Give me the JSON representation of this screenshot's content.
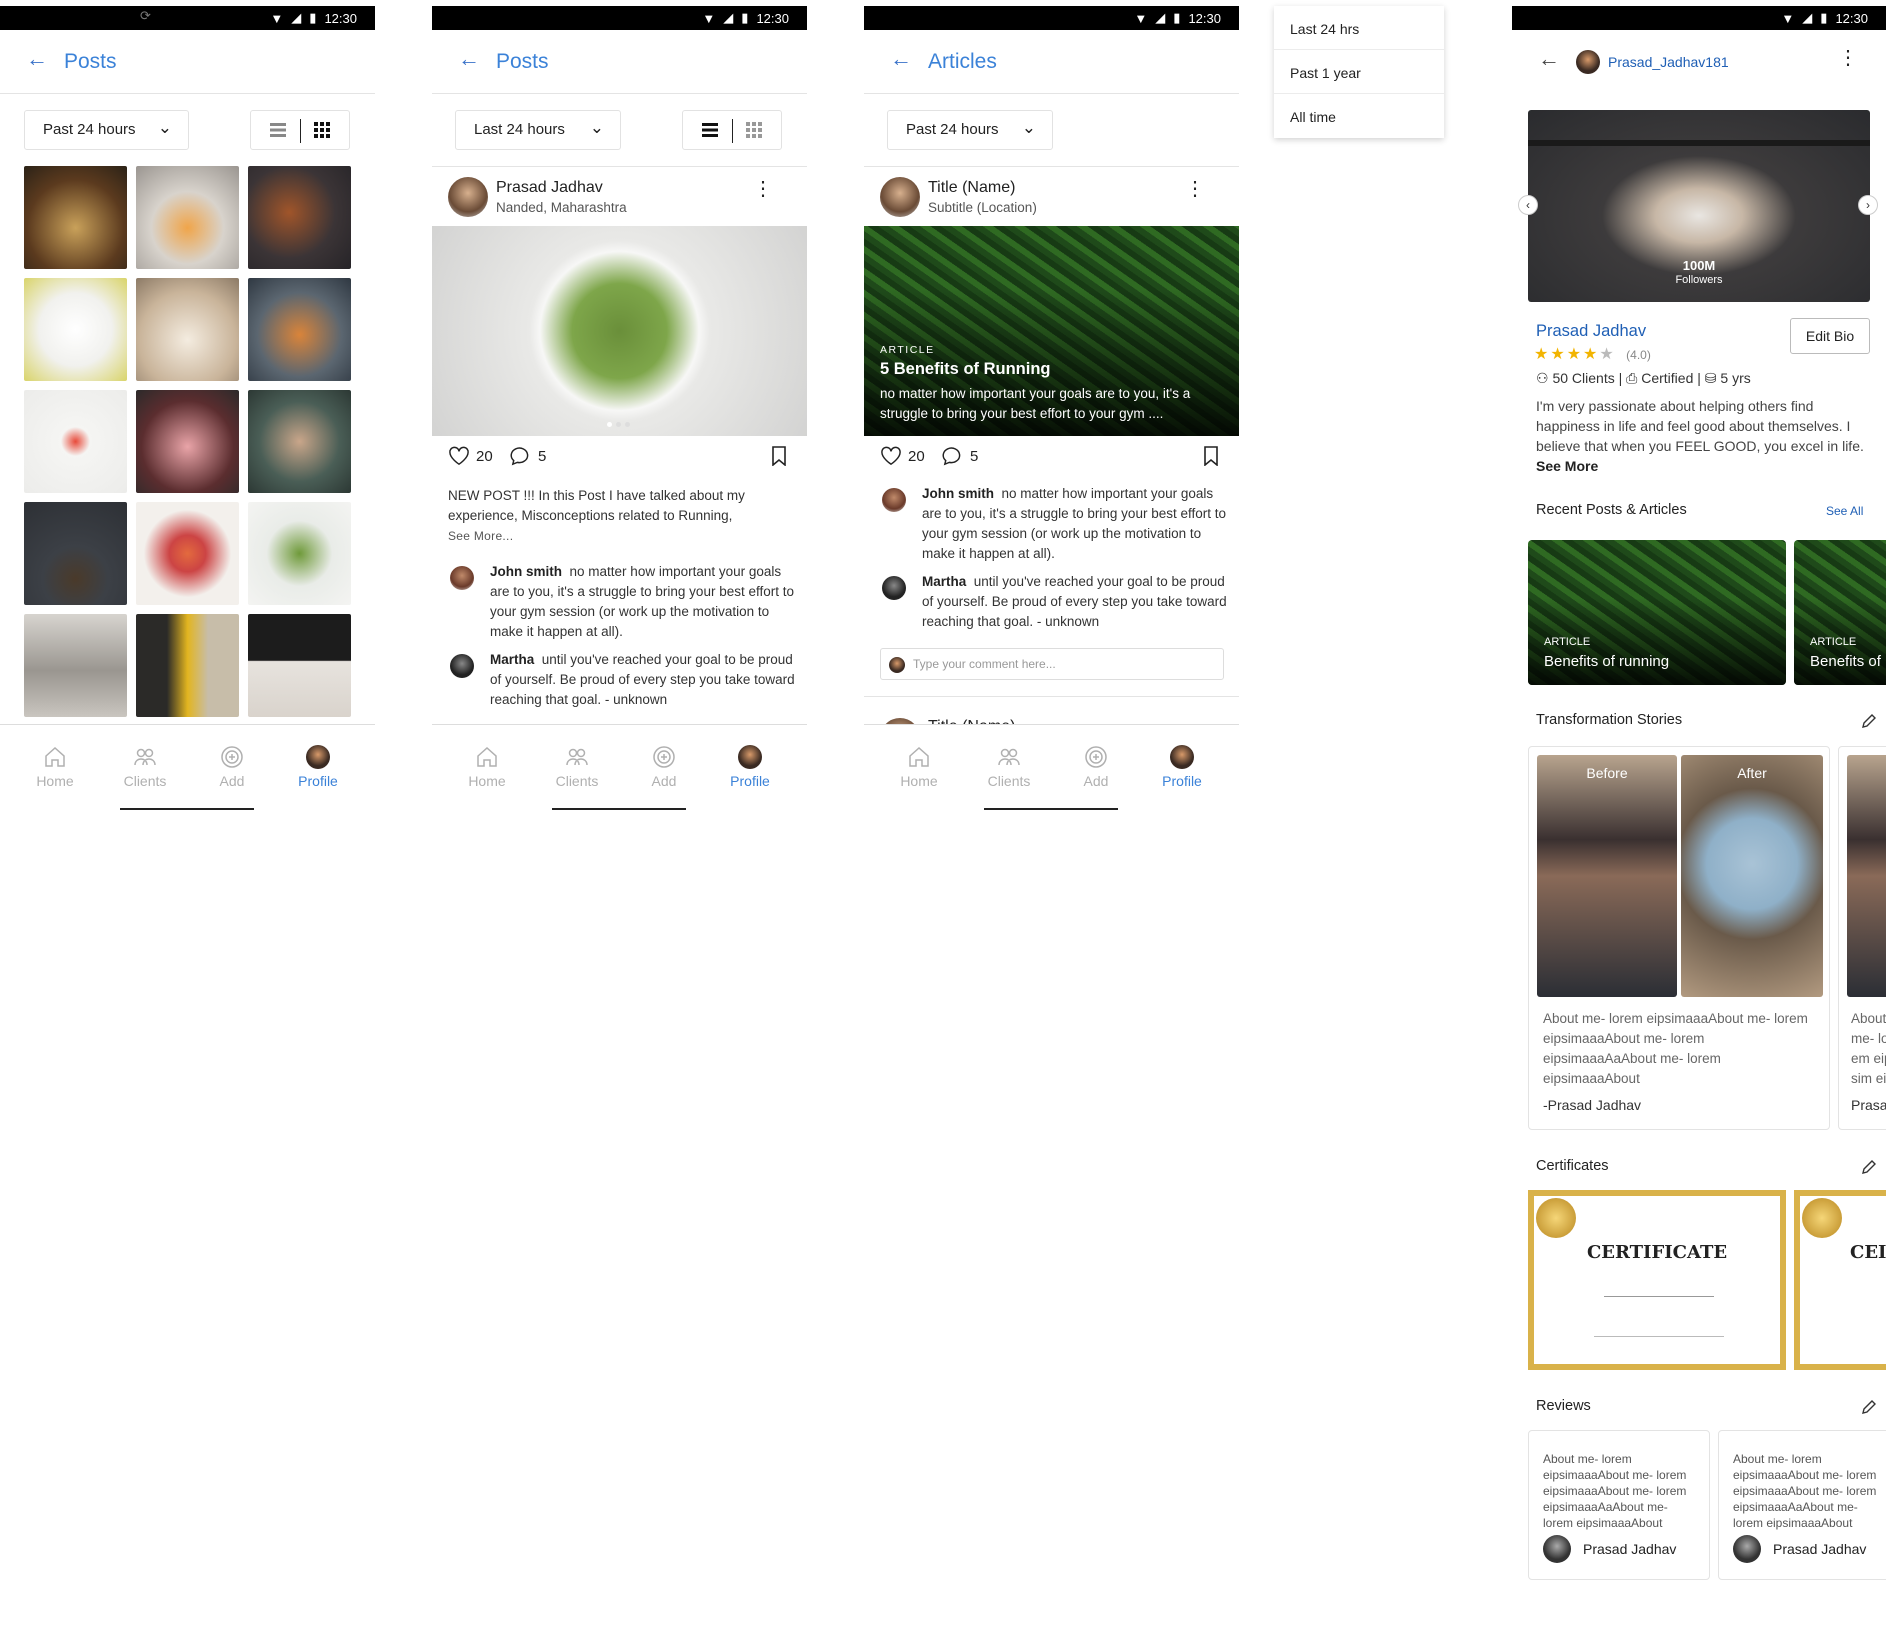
{
  "status": {
    "time": "12:30"
  },
  "screen1": {
    "title": "Posts",
    "filter": "Past 24 hours"
  },
  "screen2": {
    "title": "Posts",
    "filter": "Last 24 hours",
    "post": {
      "author": "Prasad Jadhav",
      "location": "Nanded, Maharashtra",
      "likes": "20",
      "comments": "5",
      "text": "NEW POST !!! In this Post I have talked about my experience, Misconceptions related to Running,",
      "see_more": "See More..."
    },
    "comments": [
      {
        "name": "John smith",
        "text": "no matter how important your goals are to you, it's a struggle to bring your best effort to your gym session (or work up the motivation to make it happen at all)."
      },
      {
        "name": "Martha",
        "text": "until you've reached your goal to be proud of yourself. Be proud of every step you take toward reaching that goal. - unknown"
      }
    ]
  },
  "screen3": {
    "title": "Articles",
    "filter": "Past 24 hours",
    "post": {
      "author": "Title (Name)",
      "location": "Subtitle (Location)",
      "tag": "ARTICLE",
      "headline": "5 Benefits of Running",
      "summary": "no matter how important your goals are to you, it's a struggle to bring your best effort to your gym ....",
      "likes": "20",
      "comments": "5"
    },
    "comments": [
      {
        "name": "John smith",
        "text": "no matter how important your goals are to you, it's a struggle to bring your best effort to your gym session (or work up the motivation to make it happen at all)."
      },
      {
        "name": "Martha",
        "text": "until you've reached your goal to be proud of yourself. Be proud of every step you take toward reaching that goal. - unknown"
      }
    ],
    "comment_placeholder": "Type your comment here...",
    "next_title": "Title (Name)"
  },
  "dropdown": {
    "items": [
      "Last 24 hrs",
      "Past 1 year",
      "All time"
    ]
  },
  "nav": {
    "home": "Home",
    "clients": "Clients",
    "add": "Add",
    "profile": "Profile"
  },
  "profile": {
    "username": "Prasad_Jadhav181",
    "followers_count": "100M",
    "followers_label": "Followers",
    "name": "Prasad Jadhav",
    "edit_bio": "Edit Bio",
    "rating": "(4.0)",
    "rating_value": 4,
    "clients": "50 Clients",
    "certified": "Certified",
    "experience": "5 yrs",
    "bio": "I'm very passionate about helping others find happiness in life and feel good about themselves. I believe that when you FEEL GOOD, you excel in life.",
    "bio_more": "See More",
    "recent_title": "Recent Posts & Articles",
    "see_all": "See All",
    "recent": [
      {
        "tag": "ARTICLE",
        "title": "Benefits of running"
      },
      {
        "tag": "ARTICLE",
        "title": "Benefits of"
      }
    ],
    "transform_title": "Transformation Stories",
    "before": "Before",
    "after": "After",
    "story": "About me- lorem eipsimaaaAbout me- lorem eipsimaaaAbout me- lorem eipsimaaaAaAbout me- lorem eipsimaaaAbout",
    "story_author": "-Prasad Jadhav",
    "story2": "About me- lorem eipsim eipsim",
    "story2_author": "Prasa",
    "cert_title": "Certificates",
    "cert_text": "CERTIFICATE",
    "cert_text2": "CEI",
    "reviews_title": "Reviews",
    "review_text": "About me- lorem eipsimaaaAbout me- lorem eipsimaaaAbout me- lorem eipsimaaaAaAbout me- lorem eipsimaaaAbout",
    "review_author": "Prasad Jadhav"
  },
  "colors": {
    "accent": "#3b82d8",
    "star": "#f2b400"
  }
}
